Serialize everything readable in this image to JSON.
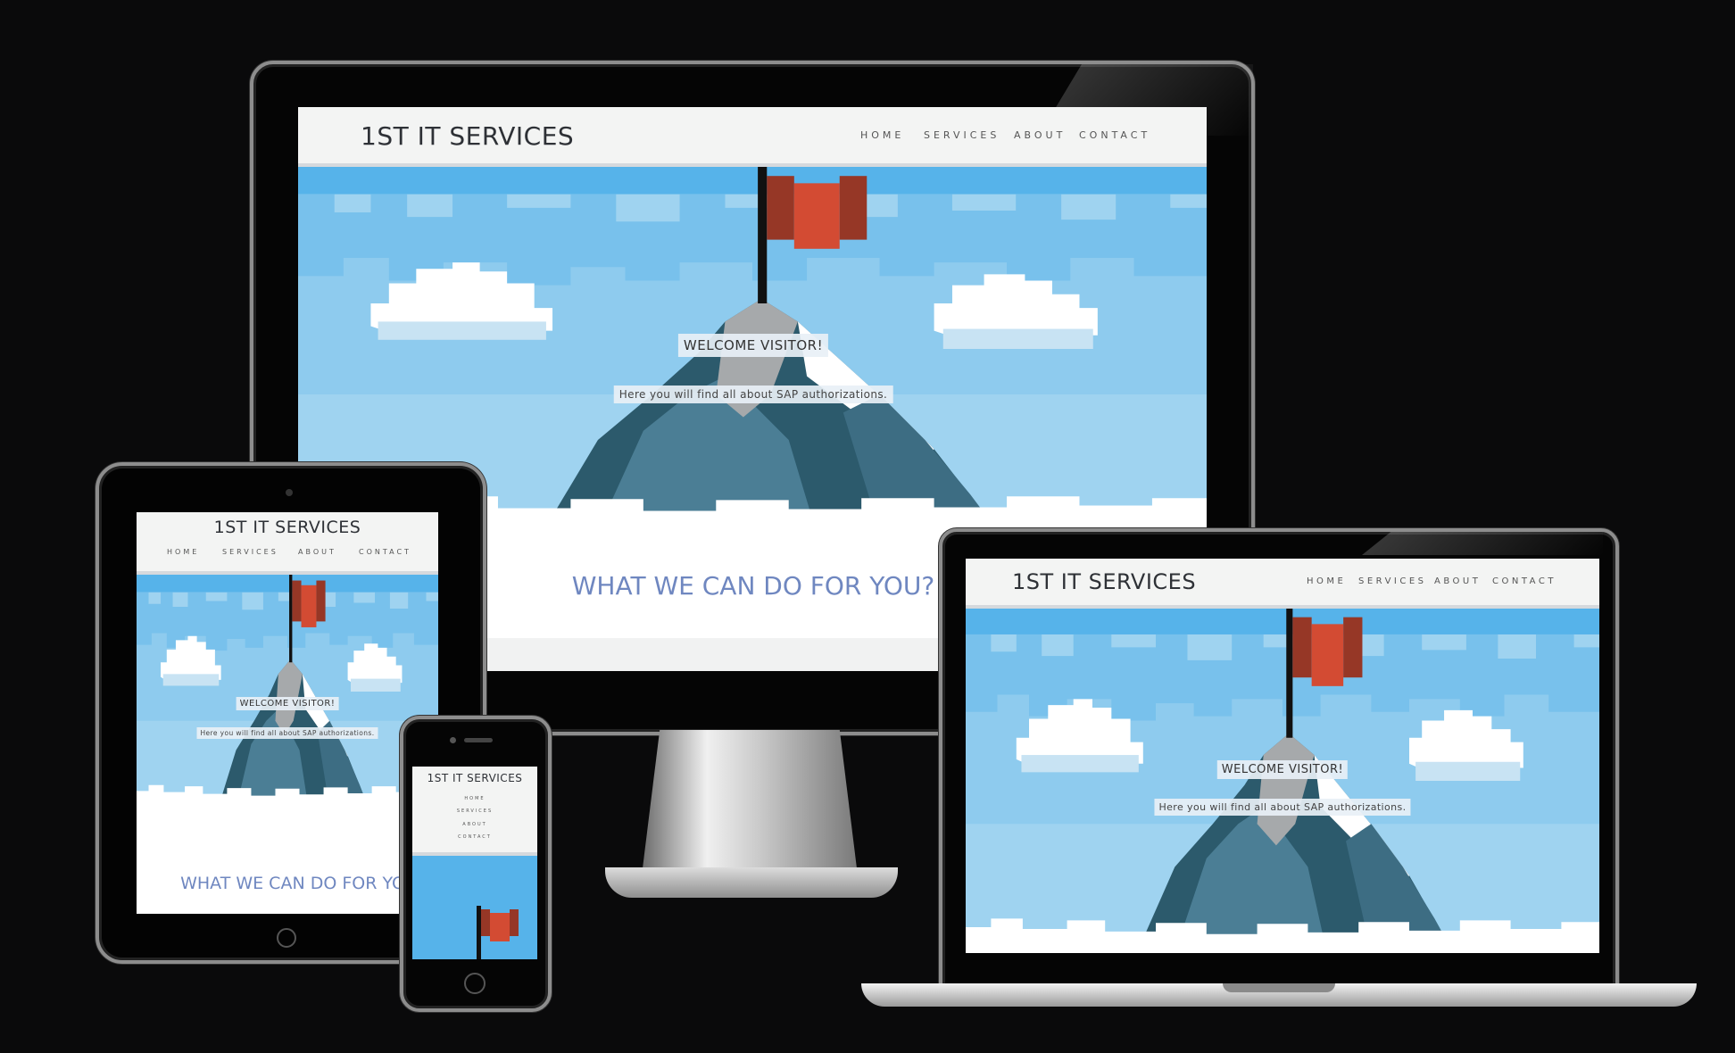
{
  "site": {
    "title": "1ST IT SERVICES",
    "nav": [
      "HOME",
      "SERVICES",
      "ABOUT",
      "CONTACT"
    ],
    "welcome": "WELCOME VISITOR!",
    "subtitle": "Here you will find all about SAP authorizations.",
    "section_title": "WHAT WE CAN DO FOR YOU?",
    "section_title_cut": "WHAT WE CAN DO FOR YOU"
  },
  "colors": {
    "background": "#0a0a0b",
    "header_bg": "#f3f4f3",
    "sky": "#5cb6ea",
    "flag": "#d34b33",
    "section_title": "#6f87c0"
  }
}
